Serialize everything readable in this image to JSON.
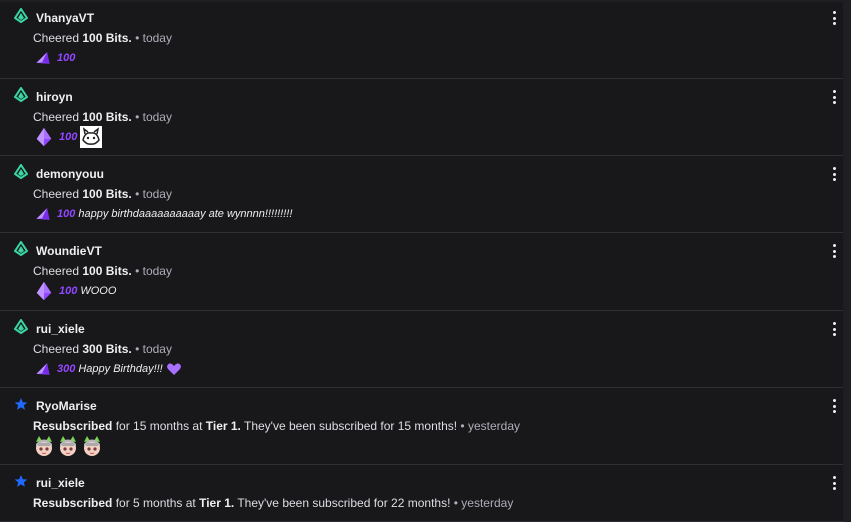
{
  "colors": {
    "background": "#18181b",
    "bits_purple": "#9147ff",
    "cheer_icon": "#3bd6a4",
    "sub_star": "#1f69ff",
    "divider": "#2f2f35"
  },
  "events": [
    {
      "type": "cheer",
      "icon": "cheer-gem-icon",
      "username": "VhanyaVT",
      "desc_prefix": "Cheered ",
      "desc_bold": "100 Bits.",
      "time": " • today",
      "amount": "100",
      "message": "",
      "has_emote": false,
      "gem": "small"
    },
    {
      "type": "cheer",
      "icon": "cheer-gem-icon",
      "username": "hiroyn",
      "desc_prefix": "Cheered ",
      "desc_bold": "100 Bits.",
      "time": " • today",
      "amount": "100",
      "message": "",
      "has_emote": true,
      "gem": "large"
    },
    {
      "type": "cheer",
      "icon": "cheer-gem-icon",
      "username": "demonyouu",
      "desc_prefix": "Cheered ",
      "desc_bold": "100 Bits.",
      "time": " • today",
      "amount": "100",
      "message": "happy birthdaaaaaaaaaay ate wynnnn!!!!!!!!!",
      "has_emote": false,
      "gem": "small"
    },
    {
      "type": "cheer",
      "icon": "cheer-gem-icon",
      "username": "WoundieVT",
      "desc_prefix": "Cheered ",
      "desc_bold": "100 Bits.",
      "time": " • today",
      "amount": "100",
      "message": "WOOO",
      "has_emote": false,
      "gem": "large"
    },
    {
      "type": "cheer",
      "icon": "cheer-gem-icon",
      "username": "rui_xiele",
      "desc_prefix": "Cheered ",
      "desc_bold": "300 Bits.",
      "time": " • today",
      "amount": "300",
      "message": "Happy Birthday!!!",
      "has_emote": false,
      "has_heart": true,
      "gem": "small"
    },
    {
      "type": "sub",
      "icon": "star-icon",
      "username": "RyoMarise",
      "desc_bold1": "Resubscribed",
      "desc_mid": " for 15 months at ",
      "desc_bold2": "Tier 1.",
      "desc_suffix": " They've been subscribed for 15 months!",
      "time": " • yesterday",
      "emote_count": 3
    },
    {
      "type": "sub",
      "icon": "star-icon",
      "username": "rui_xiele",
      "desc_bold1": "Resubscribed",
      "desc_mid": " for 5 months at ",
      "desc_bold2": "Tier 1.",
      "desc_suffix": " They've been subscribed for 22 months!",
      "time": " • yesterday",
      "emote_count": 0
    }
  ]
}
